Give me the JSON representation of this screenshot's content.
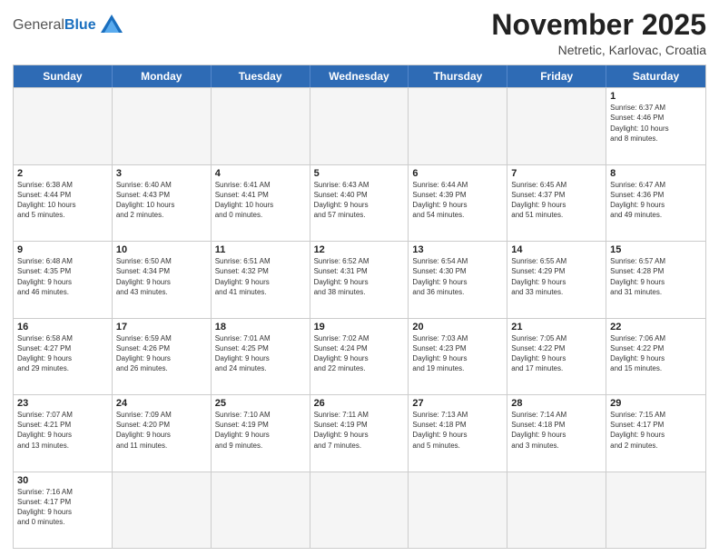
{
  "header": {
    "logo_general": "General",
    "logo_blue": "Blue",
    "month_title": "November 2025",
    "location": "Netretic, Karlovac, Croatia"
  },
  "weekdays": [
    "Sunday",
    "Monday",
    "Tuesday",
    "Wednesday",
    "Thursday",
    "Friday",
    "Saturday"
  ],
  "weeks": [
    [
      {
        "day": "",
        "info": ""
      },
      {
        "day": "",
        "info": ""
      },
      {
        "day": "",
        "info": ""
      },
      {
        "day": "",
        "info": ""
      },
      {
        "day": "",
        "info": ""
      },
      {
        "day": "",
        "info": ""
      },
      {
        "day": "1",
        "info": "Sunrise: 6:37 AM\nSunset: 4:46 PM\nDaylight: 10 hours\nand 8 minutes."
      }
    ],
    [
      {
        "day": "2",
        "info": "Sunrise: 6:38 AM\nSunset: 4:44 PM\nDaylight: 10 hours\nand 5 minutes."
      },
      {
        "day": "3",
        "info": "Sunrise: 6:40 AM\nSunset: 4:43 PM\nDaylight: 10 hours\nand 2 minutes."
      },
      {
        "day": "4",
        "info": "Sunrise: 6:41 AM\nSunset: 4:41 PM\nDaylight: 10 hours\nand 0 minutes."
      },
      {
        "day": "5",
        "info": "Sunrise: 6:43 AM\nSunset: 4:40 PM\nDaylight: 9 hours\nand 57 minutes."
      },
      {
        "day": "6",
        "info": "Sunrise: 6:44 AM\nSunset: 4:39 PM\nDaylight: 9 hours\nand 54 minutes."
      },
      {
        "day": "7",
        "info": "Sunrise: 6:45 AM\nSunset: 4:37 PM\nDaylight: 9 hours\nand 51 minutes."
      },
      {
        "day": "8",
        "info": "Sunrise: 6:47 AM\nSunset: 4:36 PM\nDaylight: 9 hours\nand 49 minutes."
      }
    ],
    [
      {
        "day": "9",
        "info": "Sunrise: 6:48 AM\nSunset: 4:35 PM\nDaylight: 9 hours\nand 46 minutes."
      },
      {
        "day": "10",
        "info": "Sunrise: 6:50 AM\nSunset: 4:34 PM\nDaylight: 9 hours\nand 43 minutes."
      },
      {
        "day": "11",
        "info": "Sunrise: 6:51 AM\nSunset: 4:32 PM\nDaylight: 9 hours\nand 41 minutes."
      },
      {
        "day": "12",
        "info": "Sunrise: 6:52 AM\nSunset: 4:31 PM\nDaylight: 9 hours\nand 38 minutes."
      },
      {
        "day": "13",
        "info": "Sunrise: 6:54 AM\nSunset: 4:30 PM\nDaylight: 9 hours\nand 36 minutes."
      },
      {
        "day": "14",
        "info": "Sunrise: 6:55 AM\nSunset: 4:29 PM\nDaylight: 9 hours\nand 33 minutes."
      },
      {
        "day": "15",
        "info": "Sunrise: 6:57 AM\nSunset: 4:28 PM\nDaylight: 9 hours\nand 31 minutes."
      }
    ],
    [
      {
        "day": "16",
        "info": "Sunrise: 6:58 AM\nSunset: 4:27 PM\nDaylight: 9 hours\nand 29 minutes."
      },
      {
        "day": "17",
        "info": "Sunrise: 6:59 AM\nSunset: 4:26 PM\nDaylight: 9 hours\nand 26 minutes."
      },
      {
        "day": "18",
        "info": "Sunrise: 7:01 AM\nSunset: 4:25 PM\nDaylight: 9 hours\nand 24 minutes."
      },
      {
        "day": "19",
        "info": "Sunrise: 7:02 AM\nSunset: 4:24 PM\nDaylight: 9 hours\nand 22 minutes."
      },
      {
        "day": "20",
        "info": "Sunrise: 7:03 AM\nSunset: 4:23 PM\nDaylight: 9 hours\nand 19 minutes."
      },
      {
        "day": "21",
        "info": "Sunrise: 7:05 AM\nSunset: 4:22 PM\nDaylight: 9 hours\nand 17 minutes."
      },
      {
        "day": "22",
        "info": "Sunrise: 7:06 AM\nSunset: 4:22 PM\nDaylight: 9 hours\nand 15 minutes."
      }
    ],
    [
      {
        "day": "23",
        "info": "Sunrise: 7:07 AM\nSunset: 4:21 PM\nDaylight: 9 hours\nand 13 minutes."
      },
      {
        "day": "24",
        "info": "Sunrise: 7:09 AM\nSunset: 4:20 PM\nDaylight: 9 hours\nand 11 minutes."
      },
      {
        "day": "25",
        "info": "Sunrise: 7:10 AM\nSunset: 4:19 PM\nDaylight: 9 hours\nand 9 minutes."
      },
      {
        "day": "26",
        "info": "Sunrise: 7:11 AM\nSunset: 4:19 PM\nDaylight: 9 hours\nand 7 minutes."
      },
      {
        "day": "27",
        "info": "Sunrise: 7:13 AM\nSunset: 4:18 PM\nDaylight: 9 hours\nand 5 minutes."
      },
      {
        "day": "28",
        "info": "Sunrise: 7:14 AM\nSunset: 4:18 PM\nDaylight: 9 hours\nand 3 minutes."
      },
      {
        "day": "29",
        "info": "Sunrise: 7:15 AM\nSunset: 4:17 PM\nDaylight: 9 hours\nand 2 minutes."
      }
    ],
    [
      {
        "day": "30",
        "info": "Sunrise: 7:16 AM\nSunset: 4:17 PM\nDaylight: 9 hours\nand 0 minutes."
      },
      {
        "day": "",
        "info": ""
      },
      {
        "day": "",
        "info": ""
      },
      {
        "day": "",
        "info": ""
      },
      {
        "day": "",
        "info": ""
      },
      {
        "day": "",
        "info": ""
      },
      {
        "day": "",
        "info": ""
      }
    ]
  ]
}
